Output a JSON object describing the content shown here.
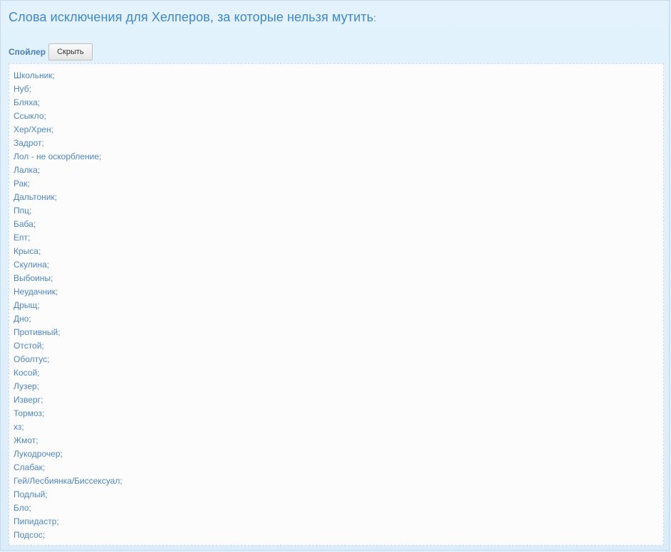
{
  "title": {
    "text": "Слова исключения для Хелперов, за которые нельзя мутить",
    "suffix": ":"
  },
  "spoiler": {
    "label": "Спойлер",
    "button_label": "Скрыть",
    "words": [
      "Школьник;",
      "Нуб;",
      "Бляха;",
      "Ссыкло;",
      "Хер/Хрен;",
      "Задрот;",
      "Лол - не оскорбление;",
      "Лалка;",
      "Рак;",
      "Дальтоник;",
      "Ппц;",
      "Баба;",
      "Епт;",
      "Крыса;",
      "Скулина;",
      "Выбоины;",
      "Неудачник;",
      "Дрыщ;",
      "Дно;",
      "Противный;",
      "Отстой;",
      "Оболтус;",
      "Косой;",
      "Лузер;",
      "Изверг;",
      "Тормоз;",
      "хз;",
      "Жмот;",
      "Лукодрочер;",
      "Слабак;",
      "Гей/Лесбиянка/Биссексуал;",
      "Подлый;",
      "Бло;",
      "Пипидастр;",
      "Подсос;"
    ]
  },
  "colors": {
    "title": "#3f87c7",
    "text": "#4d86bd",
    "background": "#dbeefb"
  }
}
